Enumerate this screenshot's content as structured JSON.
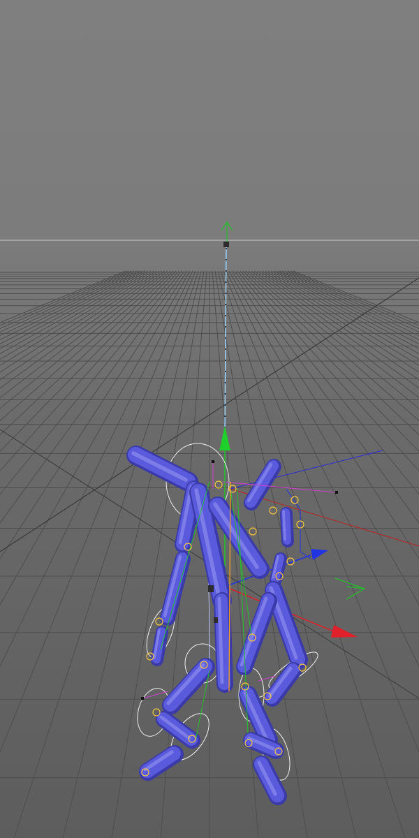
{
  "viewport": {
    "name": "3d-perspective-viewport",
    "background_top": "#7f7f7f",
    "background_bottom": "#5d5d5d",
    "grid_color": "#4a4a4a",
    "horizon_color": "#c8c8c8"
  },
  "rig": {
    "limb_color": "#5a5adc",
    "limb_highlight": "#8c8cf0",
    "limb_shadow": "#3a3aa8",
    "controller_color": "#f0f0f0",
    "joint_marker_color": "#f5c542"
  },
  "gizmo": {
    "x_axis_color": "#e0202a",
    "y_axis_color": "#22c02a",
    "z_axis_color": "#2233e0"
  },
  "icons": [
    "move-gizmo-icon",
    "axis-arrow-icon",
    "joint-marker-icon",
    "null-object-icon"
  ]
}
